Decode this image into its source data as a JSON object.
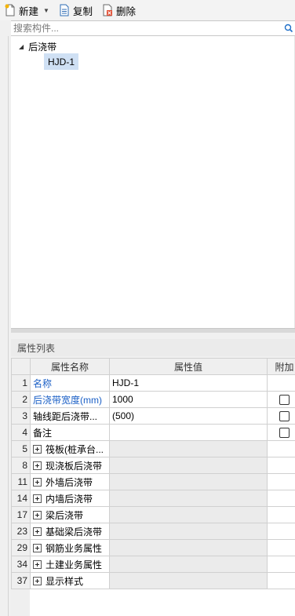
{
  "toolbar": {
    "new_label": "新建",
    "copy_label": "复制",
    "delete_label": "删除"
  },
  "search": {
    "placeholder": "搜索构件..."
  },
  "tree": {
    "parent_label": "后浇带",
    "child_label": "HJD-1"
  },
  "properties": {
    "title": "属性列表",
    "headers": {
      "name": "属性名称",
      "value": "属性值",
      "extra": "附加"
    },
    "rows": [
      {
        "num": "1",
        "name": "名称",
        "value": "HJD-1",
        "highlight": true,
        "checkbox": false,
        "expandable": false
      },
      {
        "num": "2",
        "name": "后浇带宽度(mm)",
        "value": "1000",
        "highlight": true,
        "checkbox": true,
        "expandable": false
      },
      {
        "num": "3",
        "name": "轴线距后浇带...",
        "value": "(500)",
        "highlight": false,
        "checkbox": true,
        "expandable": false
      },
      {
        "num": "4",
        "name": "备注",
        "value": "",
        "highlight": false,
        "checkbox": true,
        "expandable": false
      },
      {
        "num": "5",
        "name": "筏板(桩承台...",
        "value": "",
        "highlight": false,
        "checkbox": false,
        "expandable": true
      },
      {
        "num": "8",
        "name": "现浇板后浇带",
        "value": "",
        "highlight": false,
        "checkbox": false,
        "expandable": true
      },
      {
        "num": "11",
        "name": "外墙后浇带",
        "value": "",
        "highlight": false,
        "checkbox": false,
        "expandable": true
      },
      {
        "num": "14",
        "name": "内墙后浇带",
        "value": "",
        "highlight": false,
        "checkbox": false,
        "expandable": true
      },
      {
        "num": "17",
        "name": "梁后浇带",
        "value": "",
        "highlight": false,
        "checkbox": false,
        "expandable": true
      },
      {
        "num": "23",
        "name": "基础梁后浇带",
        "value": "",
        "highlight": false,
        "checkbox": false,
        "expandable": true
      },
      {
        "num": "29",
        "name": "钢筋业务属性",
        "value": "",
        "highlight": false,
        "checkbox": false,
        "expandable": true
      },
      {
        "num": "34",
        "name": "土建业务属性",
        "value": "",
        "highlight": false,
        "checkbox": false,
        "expandable": true
      },
      {
        "num": "37",
        "name": "显示样式",
        "value": "",
        "highlight": false,
        "checkbox": false,
        "expandable": true
      }
    ]
  },
  "colors": {
    "highlight_text": "#1a5fc6",
    "selection_bg": "#cfe0f4",
    "group_value_bg": "#ebebeb"
  }
}
